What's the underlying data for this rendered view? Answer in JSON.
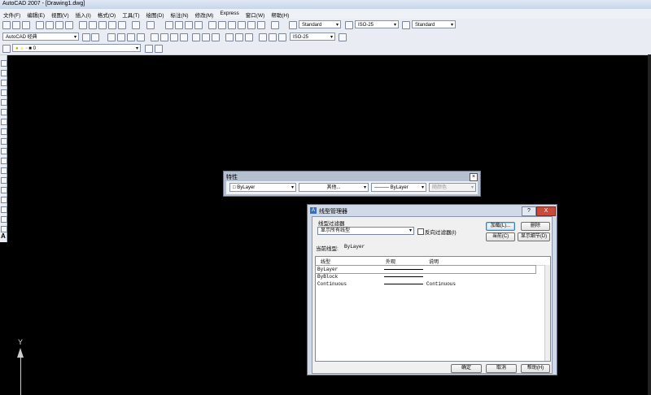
{
  "app": {
    "title": "AutoCAD 2007 - [Drawing1.dwg]"
  },
  "menu": [
    "文件(F)",
    "编辑(E)",
    "视图(V)",
    "插入(I)",
    "格式(O)",
    "工具(T)",
    "绘图(D)",
    "标注(N)",
    "修改(M)",
    "Express",
    "窗口(W)",
    "帮助(H)"
  ],
  "toolbar1": {
    "text_style": "Standard",
    "dim_style": "ISO-25",
    "table_style": "Standard"
  },
  "toolbar2": {
    "workspace": "AutoCAD 经典",
    "dim_style2": "ISO-25"
  },
  "toolbar3": {
    "layer": "0"
  },
  "ucs": {
    "y_label": "Y"
  },
  "properties": {
    "title": "特性",
    "color": "ByLayer",
    "linetype_other": "其他...",
    "lineweight": "ByLayer",
    "plot_style": "随颜色"
  },
  "dialog": {
    "title": "线型管理器",
    "help_label": "?",
    "close_label": "X",
    "filter_label": "线型过滤器",
    "filter_value": "显示所有线型",
    "invert_filter_label": "反向过滤器(I)",
    "load_label": "加载(L)...",
    "delete_label": "删除",
    "current_btn_label": "当前(C)",
    "details_label": "显示细节(D)",
    "current_linetype_label": "当前线型:",
    "current_linetype_value": "ByLayer",
    "columns": {
      "linetype": "线型",
      "appearance": "外观",
      "description": "说明"
    },
    "rows": [
      {
        "name": "ByLayer",
        "desc": ""
      },
      {
        "name": "ByBlock",
        "desc": ""
      },
      {
        "name": "Continuous",
        "desc": "Continuous"
      }
    ],
    "ok_label": "确定",
    "cancel_label": "取消",
    "help_btn_label": "帮助(H)"
  }
}
